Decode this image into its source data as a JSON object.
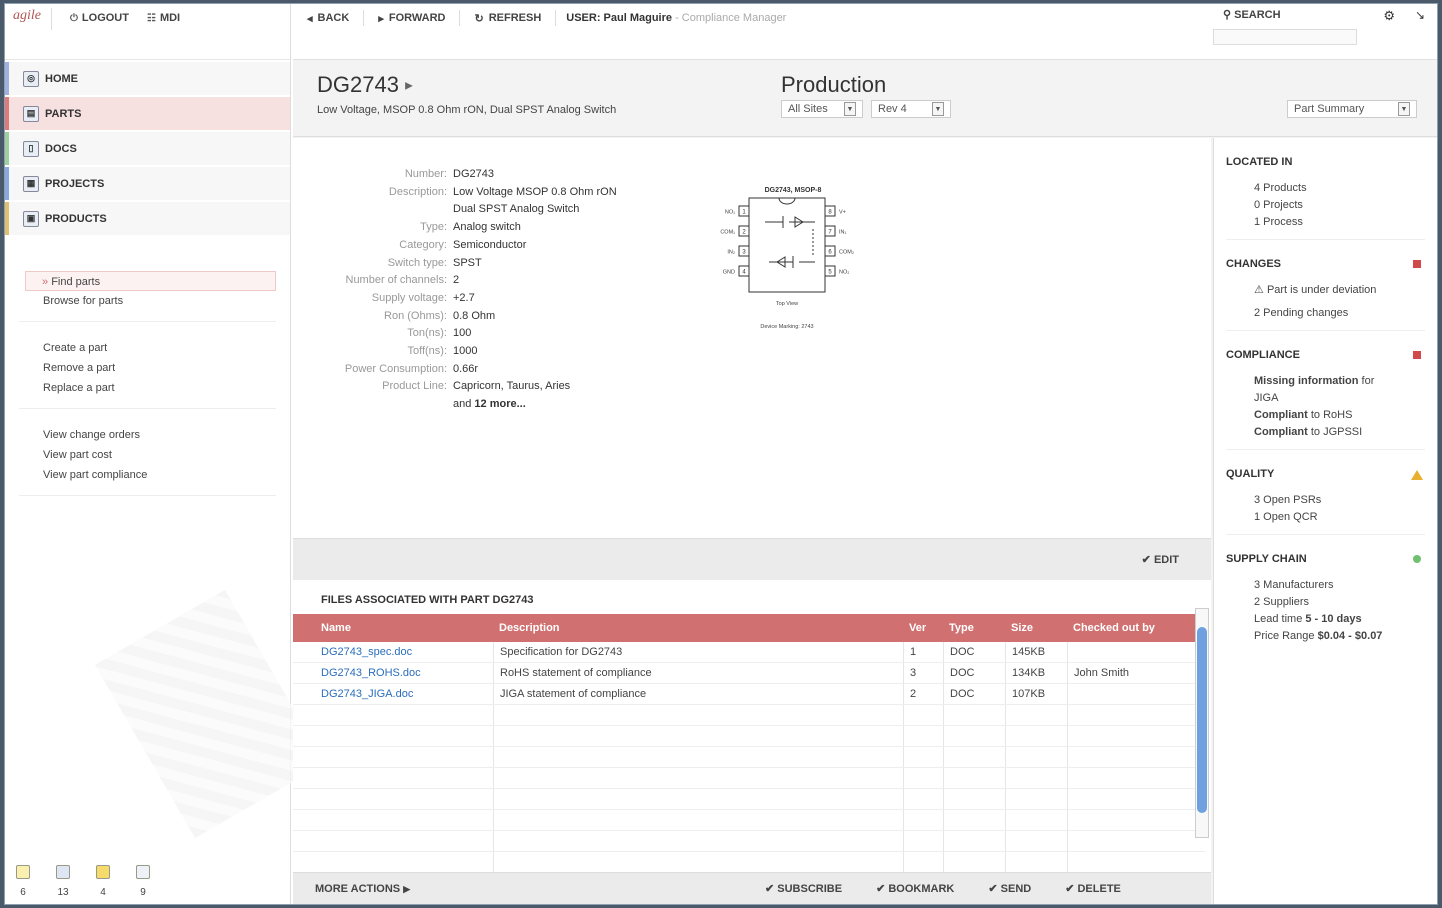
{
  "topbar_left": {
    "logo": "agile",
    "logout": "LOGOUT",
    "mdi": "MDI"
  },
  "nav": {
    "items": [
      {
        "label": "HOME"
      },
      {
        "label": "PARTS"
      },
      {
        "label": "DOCS"
      },
      {
        "label": "PROJECTS"
      },
      {
        "label": "PRODUCTS"
      }
    ],
    "accent_colors": [
      "#a0b0e0",
      "#e07a7a",
      "#9ed09e",
      "#8aa8e0",
      "#e0c070"
    ]
  },
  "links": {
    "group1": [
      "Find parts",
      "Browse for parts"
    ],
    "group2": [
      "Create a part",
      "Remove a part",
      "Replace a part"
    ],
    "group3": [
      "View change orders",
      "View part cost",
      "View part compliance"
    ]
  },
  "bottom_counts": [
    "6",
    "13",
    "4",
    "9"
  ],
  "topbar": {
    "back": "BACK",
    "forward": "FORWARD",
    "refresh": "REFRESH",
    "user_prefix": "USER: Paul Maguire",
    "user_role": " - Compliance Manager",
    "search": "SEARCH"
  },
  "header": {
    "part_number": "DG2743",
    "part_description": "Low Voltage, MSOP 0.8 Ohm rON, Dual SPST Analog Switch",
    "status": "Production",
    "sites": "All Sites",
    "rev": "Rev 4",
    "view": "Part Summary"
  },
  "props": [
    {
      "k": "Number:",
      "v": "DG2743"
    },
    {
      "k": "Description:",
      "v": "Low Voltage MSOP 0.8 Ohm rON"
    },
    {
      "k": "",
      "v": "Dual SPST Analog Switch"
    },
    {
      "k": "Type:",
      "v": "Analog switch"
    },
    {
      "k": "Category:",
      "v": "Semiconductor"
    },
    {
      "k": "Switch type:",
      "v": "SPST"
    },
    {
      "k": "Number of channels:",
      "v": "2"
    },
    {
      "k": "Supply voltage:",
      "v": "+2.7"
    },
    {
      "k": "Ron (Ohms):",
      "v": "0.8 Ohm"
    },
    {
      "k": "Ton(ns):",
      "v": "100"
    },
    {
      "k": "Toff(ns):",
      "v": "1000"
    },
    {
      "k": "Power Consumption:",
      "v": "0.66r"
    },
    {
      "k": "Product Line:",
      "v": "Capricorn, Taurus, Aries"
    }
  ],
  "props_more": {
    "prefix": "and ",
    "count": "12 more..."
  },
  "schematic": {
    "title": "DG2743, MSOP-8",
    "top_view": "Top View",
    "marking": "Device Marking: 2743",
    "left_pins": [
      "NO₁",
      "COM₁",
      "IN₂",
      "GND"
    ],
    "right_pins": [
      "V+",
      "IN₁",
      "COM₂",
      "NO₂"
    ],
    "left_nums": [
      "1",
      "2",
      "3",
      "4"
    ],
    "right_nums": [
      "8",
      "7",
      "6",
      "5"
    ]
  },
  "edit": "EDIT",
  "files": {
    "title": "FILES ASSOCIATED WITH PART DG2743",
    "columns": [
      "Name",
      "Description",
      "Ver",
      "Type",
      "Size",
      "Checked out by"
    ],
    "rows": [
      [
        "DG2743_spec.doc",
        "Specification for DG2743",
        "1",
        "DOC",
        "145KB",
        ""
      ],
      [
        "DG2743_ROHS.doc",
        "RoHS statement of compliance",
        "3",
        "DOC",
        "134KB",
        "John Smith"
      ],
      [
        "DG2743_JIGA.doc",
        "JIGA statement of compliance",
        "2",
        "DOC",
        "107KB",
        ""
      ]
    ]
  },
  "actions": {
    "more": "MORE ACTIONS",
    "subscribe": "SUBSCRIBE",
    "bookmark": "BOOKMARK",
    "send": "SEND",
    "delete": "DELETE"
  },
  "right": {
    "located_in": {
      "title": "LOCATED IN",
      "lines": [
        "4 Products",
        "0 Projects",
        "1 Process"
      ]
    },
    "changes": {
      "title": "CHANGES",
      "lines": [
        "Part is under deviation",
        "2 Pending changes"
      ],
      "status_color": "#d04a4a"
    },
    "compliance": {
      "title": "COMPLIANCE",
      "status_color": "#d04a4a",
      "l1a": "Missing information",
      "l1b": " for",
      "l1c": "JIGA",
      "l2a": "Compliant",
      "l2b": " to RoHS",
      "l3a": "Compliant",
      "l3b": " to JGPSSI"
    },
    "quality": {
      "title": "QUALITY",
      "lines": [
        "3 Open PSRs",
        "1 Open QCR"
      ],
      "status_color": "#e8b030"
    },
    "supply": {
      "title": "SUPPLY CHAIN",
      "status_color": "#70c070",
      "l1": "3 Manufacturers",
      "l2": "2 Suppliers",
      "l3a": "Lead time ",
      "l3b": "5 - 10 days",
      "l4a": "Price Range ",
      "l4b": "$0.04 - $0.07"
    }
  }
}
